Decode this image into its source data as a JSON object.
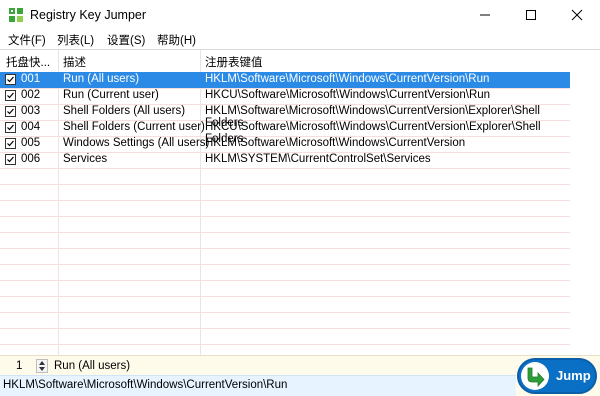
{
  "window": {
    "title": "Registry Key Jumper"
  },
  "menu": [
    "文件(F)",
    "列表(L)",
    "设置(S)",
    "帮助(H)"
  ],
  "table": {
    "headers": [
      "托盘快...",
      "描述",
      "注册表键值"
    ],
    "rows": [
      {
        "checked": true,
        "id": "001",
        "desc": "Run (All users)",
        "key": "HKLM\\Software\\Microsoft\\Windows\\CurrentVersion\\Run",
        "selected": true
      },
      {
        "checked": true,
        "id": "002",
        "desc": "Run (Current user)",
        "key": "HKCU\\Software\\Microsoft\\Windows\\CurrentVersion\\Run",
        "selected": false
      },
      {
        "checked": true,
        "id": "003",
        "desc": "Shell Folders (All users)",
        "key": "HKLM\\Software\\Microsoft\\Windows\\CurrentVersion\\Explorer\\Shell Folders",
        "selected": false
      },
      {
        "checked": true,
        "id": "004",
        "desc": "Shell Folders (Current user)",
        "key": "HKCU\\Software\\Microsoft\\Windows\\CurrentVersion\\Explorer\\Shell Folders",
        "selected": false
      },
      {
        "checked": true,
        "id": "005",
        "desc": "Windows Settings (All users)",
        "key": "HKLM\\Software\\Microsoft\\Windows\\CurrentVersion",
        "selected": false
      },
      {
        "checked": true,
        "id": "006",
        "desc": "Services",
        "key": "HKLM\\SYSTEM\\CurrentControlSet\\Services",
        "selected": false
      }
    ]
  },
  "status": {
    "index": "1",
    "label": "Run (All users)",
    "path": "HKLM\\Software\\Microsoft\\Windows\\CurrentVersion\\Run",
    "jump_label": "Jump"
  },
  "colors": {
    "selection": "#2a8ae5",
    "jump_button": "#0a70c6",
    "status_bg": "#fffbea",
    "path_bg": "#e7f3ff"
  }
}
